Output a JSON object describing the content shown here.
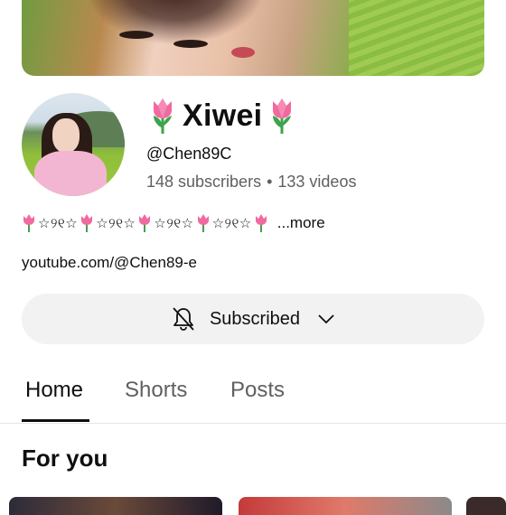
{
  "channel": {
    "name": "Xiwei",
    "handle": "@Chen89C",
    "stats": {
      "subscribers": "148 subscribers",
      "separator": "•",
      "videos": "133 videos"
    },
    "description": {
      "stars_1": "☆୨୧☆",
      "stars_2": "☆୨୧☆",
      "stars_3": "☆୨୧☆",
      "stars_4": "☆୨୧☆",
      "more": "...more"
    },
    "link": "youtube.com/@Chen89-e"
  },
  "subscribe": {
    "label": "Subscribed",
    "bell_icon": "bell-off-icon",
    "chevron_icon": "chevron-down-icon"
  },
  "tabs": [
    {
      "label": "Home",
      "active": true
    },
    {
      "label": "Shorts",
      "active": false
    },
    {
      "label": "Posts",
      "active": false
    }
  ],
  "section": {
    "title": "For you"
  },
  "colors": {
    "text_primary": "#0f0f0f",
    "text_secondary": "#606060",
    "button_bg": "#f2f2f2",
    "divider": "#e5e5e5",
    "tulip_pink": "#f06aa0",
    "tulip_leaf": "#3fa34d"
  }
}
